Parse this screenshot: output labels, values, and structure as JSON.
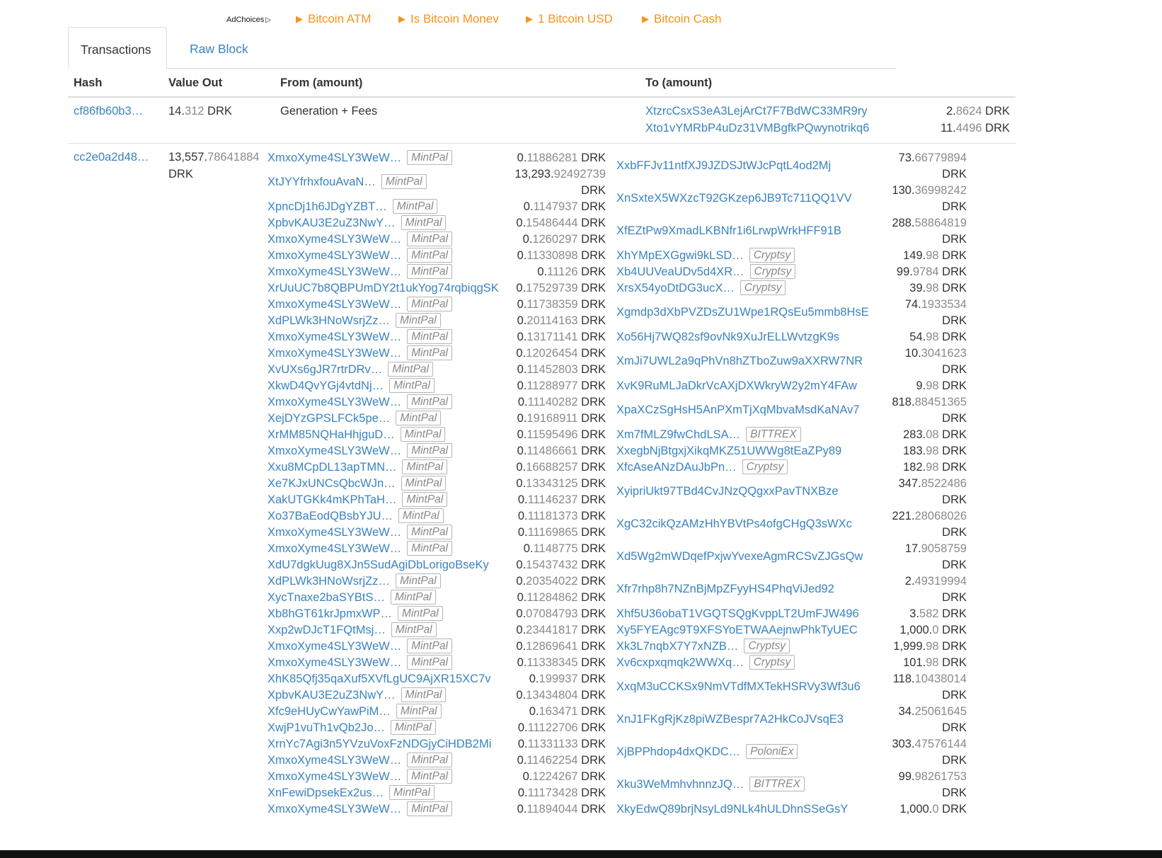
{
  "ads": {
    "adchoices": "AdChoices",
    "links": [
      "Bitcoin ATM",
      "Is Bitcoin Monev",
      "1 Bitcoin USD",
      "Bitcoin Cash"
    ]
  },
  "tabs": {
    "transactions": "Transactions",
    "raw_block": "Raw Block"
  },
  "headers": {
    "hash": "Hash",
    "value_out": "Value Out",
    "from": "From (amount)",
    "to": "To (amount)"
  },
  "coinbase_tx": {
    "hash": "cf86fb60b3…",
    "value_int": "14.",
    "value_dec": "312",
    "value_unit": " DRK",
    "from": "Generation + Fees",
    "to": [
      {
        "addr": "XtzrcCsxS3eA3LejArCt7F7BdWC33MR9ry",
        "int": "2.",
        "dec": "8624"
      },
      {
        "addr": "Xto1vYMRbP4uDz31VMBgfkPQwynotrikq6",
        "int": "11.",
        "dec": "4496"
      }
    ]
  },
  "big_tx": {
    "hash": "cc2e0a2d48…",
    "value_int": "13,557.",
    "value_dec": "78641884",
    "value_unit": "DRK",
    "inputs": [
      {
        "addr": "XmxoXyme4SLY3WeW…",
        "tag": "MintPal",
        "int": "0.",
        "dec": "11886281"
      },
      {
        "addr": "XtJYYfrhxfouAvaN…",
        "tag": "MintPal",
        "int": "13,293.",
        "dec": "92492739"
      },
      {
        "addr": "XpncDj1h6JDgYZBT…",
        "tag": "MintPal",
        "int": "0.",
        "dec": "1147937"
      },
      {
        "addr": "XpbvKAU3E2uZ3NwY…",
        "tag": "MintPal",
        "int": "0.",
        "dec": "15486444"
      },
      {
        "addr": "XmxoXyme4SLY3WeW…",
        "tag": "MintPal",
        "int": "0.",
        "dec": "1260297"
      },
      {
        "addr": "XmxoXyme4SLY3WeW…",
        "tag": "MintPal",
        "int": "0.",
        "dec": "11330898"
      },
      {
        "addr": "XmxoXyme4SLY3WeW…",
        "tag": "MintPal",
        "int": "0.",
        "dec": "11126"
      },
      {
        "addr": "XrUuUC7b8QBPUmDY2t1ukYog74rqbiqgSK",
        "tag": "",
        "int": "0.",
        "dec": "17529739"
      },
      {
        "addr": "XmxoXyme4SLY3WeW…",
        "tag": "MintPal",
        "int": "0.",
        "dec": "11738359"
      },
      {
        "addr": "XdPLWk3HNoWsrjZz…",
        "tag": "MintPal",
        "int": "0.",
        "dec": "20114163"
      },
      {
        "addr": "XmxoXyme4SLY3WeW…",
        "tag": "MintPal",
        "int": "0.",
        "dec": "13171141"
      },
      {
        "addr": "XmxoXyme4SLY3WeW…",
        "tag": "MintPal",
        "int": "0.",
        "dec": "12026454"
      },
      {
        "addr": "XvUXs6gJR7rtrDRv…",
        "tag": "MintPal",
        "int": "0.",
        "dec": "11452803"
      },
      {
        "addr": "XkwD4QvYGj4vtdNj…",
        "tag": "MintPal",
        "int": "0.",
        "dec": "11288977"
      },
      {
        "addr": "XmxoXyme4SLY3WeW…",
        "tag": "MintPal",
        "int": "0.",
        "dec": "11140282"
      },
      {
        "addr": "XejDYzGPSLFCk5pe…",
        "tag": "MintPal",
        "int": "0.",
        "dec": "19168911"
      },
      {
        "addr": "XrMM85NQHaHhjguD…",
        "tag": "MintPal",
        "int": "0.",
        "dec": "11595496"
      },
      {
        "addr": "XmxoXyme4SLY3WeW…",
        "tag": "MintPal",
        "int": "0.",
        "dec": "11486661"
      },
      {
        "addr": "Xxu8MCpDL13apTMN…",
        "tag": "MintPal",
        "int": "0.",
        "dec": "16688257"
      },
      {
        "addr": "Xe7KJxUNCsQbcWJn…",
        "tag": "MintPal",
        "int": "0.",
        "dec": "13343125"
      },
      {
        "addr": "XakUTGKk4mKPhTaH…",
        "tag": "MintPal",
        "int": "0.",
        "dec": "11146237"
      },
      {
        "addr": "Xo37BaEodQBsbYJU…",
        "tag": "MintPal",
        "int": "0.",
        "dec": "11181373"
      },
      {
        "addr": "XmxoXyme4SLY3WeW…",
        "tag": "MintPal",
        "int": "0.",
        "dec": "11169865"
      },
      {
        "addr": "XmxoXyme4SLY3WeW…",
        "tag": "MintPal",
        "int": "0.",
        "dec": "1148775"
      },
      {
        "addr": "XdU7dgkUug8XJn5SudAgiDbLorigoBseKy",
        "tag": "",
        "int": "0.",
        "dec": "15437432"
      },
      {
        "addr": "XdPLWk3HNoWsrjZz…",
        "tag": "MintPal",
        "int": "0.",
        "dec": "20354022"
      },
      {
        "addr": "XycTnaxe2baSYBtS…",
        "tag": "MintPal",
        "int": "0.",
        "dec": "11284862"
      },
      {
        "addr": "Xb8hGT61krJpmxWP…",
        "tag": "MintPal",
        "int": "0.",
        "dec": "07084793"
      },
      {
        "addr": "Xxp2wDJcT1FQtMsj…",
        "tag": "MintPal",
        "int": "0.",
        "dec": "23441817"
      },
      {
        "addr": "XmxoXyme4SLY3WeW…",
        "tag": "MintPal",
        "int": "0.",
        "dec": "12869641"
      },
      {
        "addr": "XmxoXyme4SLY3WeW…",
        "tag": "MintPal",
        "int": "0.",
        "dec": "11338345"
      },
      {
        "addr": "XhK85Qfj35qaXuf5XVfLgUC9AjXR15XC7v",
        "tag": "",
        "int": "0.",
        "dec": "199937"
      },
      {
        "addr": "XpbvKAU3E2uZ3NwY…",
        "tag": "MintPal",
        "int": "0.",
        "dec": "13434804"
      },
      {
        "addr": "Xfc9eHUyCwYawPiM…",
        "tag": "MintPal",
        "int": "0.",
        "dec": "163471"
      },
      {
        "addr": "XwjP1vuTh1vQb2Jo…",
        "tag": "MintPal",
        "int": "0.",
        "dec": "11122706"
      },
      {
        "addr": "XrnYc7Agi3n5YVzuVoxFzNDGjyCiHDB2Mi",
        "tag": "",
        "int": "0.",
        "dec": "11331133"
      },
      {
        "addr": "XmxoXyme4SLY3WeW…",
        "tag": "MintPal",
        "int": "0.",
        "dec": "11462254"
      },
      {
        "addr": "XmxoXyme4SLY3WeW…",
        "tag": "MintPal",
        "int": "0.",
        "dec": "1224267"
      },
      {
        "addr": "XnFewiDpsekEx2us…",
        "tag": "MintPal",
        "int": "0.",
        "dec": "11173428"
      },
      {
        "addr": "XmxoXyme4SLY3WeW…",
        "tag": "MintPal",
        "int": "0.",
        "dec": "11894044"
      }
    ],
    "outputs": [
      {
        "addr": "XxbFFJv11ntfXJ9JZDSJtWJcPqtL4od2Mj",
        "tag": "",
        "int": "73.",
        "dec": "66779894",
        "wrap": true
      },
      {
        "addr": "XnSxteX5WXzcT92GKzep6JB9Tc711QQ1VV",
        "tag": "",
        "int": "130.",
        "dec": "36998242",
        "wrap": true
      },
      {
        "addr": "XfEZtPw9XmadLKBNfr1i6LrwpWrkHFF91B",
        "tag": "",
        "int": "288.",
        "dec": "58864819",
        "wrap": true
      },
      {
        "addr": "XhYMpEXGgwi9kLSD…",
        "tag": "Cryptsy",
        "int": "149.",
        "dec": "98",
        "wrap": false
      },
      {
        "addr": "Xb4UUVeaUDv5d4XR…",
        "tag": "Cryptsy",
        "int": "99.",
        "dec": "9784",
        "wrap": false
      },
      {
        "addr": "XrsX54yoDtDG3ucX…",
        "tag": "Cryptsy",
        "int": "39.",
        "dec": "98",
        "wrap": false
      },
      {
        "addr": "Xgmdp3dXbPVZDsZU1Wpe1RQsEu5mmb8HsE",
        "tag": "",
        "int": "74.",
        "dec": "1933534",
        "wrap": true
      },
      {
        "addr": "Xo56Hj7WQ82sf9ovNk9XuJrELLWvtzgK9s",
        "tag": "",
        "int": "54.",
        "dec": "98",
        "wrap": false
      },
      {
        "addr": "XmJi7UWL2a9qPhVn8hZTboZuw9aXXRW7NR",
        "tag": "",
        "int": "10.",
        "dec": "3041623",
        "wrap": true
      },
      {
        "addr": "XvK9RuMLJaDkrVcAXjDXWkryW2y2mY4FAw",
        "tag": "",
        "int": "9.",
        "dec": "98",
        "wrap": false
      },
      {
        "addr": "XpaXCzSgHsH5AnPXmTjXqMbvaMsdKaNAv7",
        "tag": "",
        "int": "818.",
        "dec": "88451365",
        "wrap": true
      },
      {
        "addr": "Xm7fMLZ9fwChdLSA…",
        "tag": "BITTREX",
        "int": "283.",
        "dec": "08",
        "wrap": false
      },
      {
        "addr": "XxegbNjBtgxjXikqMKZ51UWWg8tEaZPy89",
        "tag": "",
        "int": "183.",
        "dec": "98",
        "wrap": false
      },
      {
        "addr": "XfcAseANzDAuJbPn…",
        "tag": "Cryptsy",
        "int": "182.",
        "dec": "98",
        "wrap": false
      },
      {
        "addr": "XyipriUkt97TBd4CvJNzQQgxxPavTNXBze",
        "tag": "",
        "int": "347.",
        "dec": "8522486",
        "wrap": true
      },
      {
        "addr": "XgC32cikQzAMzHhYBVtPs4ofgCHgQ3sWXc",
        "tag": "",
        "int": "221.",
        "dec": "28068026",
        "wrap": true
      },
      {
        "addr": "Xd5Wg2mWDqefPxjwYvexeAgmRCSvZJGsQw",
        "tag": "",
        "int": "17.",
        "dec": "9058759",
        "wrap": true
      },
      {
        "addr": "Xfr7rhp8h7NZnBjMpZFyyHS4PhqViJed92",
        "tag": "",
        "int": "2.",
        "dec": "49319994",
        "wrap": true
      },
      {
        "addr": "Xhf5U36obaT1VGQTSQgKvppLT2UmFJW496",
        "tag": "",
        "int": "3.",
        "dec": "582",
        "wrap": false
      },
      {
        "addr": "Xy5FYEAgc9T9XFSYoETWAAejnwPhkTyUEC",
        "tag": "",
        "int": "1,000.",
        "dec": "0",
        "wrap": false
      },
      {
        "addr": "Xk3L7nqbX7Y7xNZB…",
        "tag": "Cryptsy",
        "int": "1,999.",
        "dec": "98",
        "wrap": false
      },
      {
        "addr": "Xv6cxpxqmqk2WWXq…",
        "tag": "Cryptsy",
        "int": "101.",
        "dec": "98",
        "wrap": false
      },
      {
        "addr": "XxqM3uCCKSx9NmVTdfMXTekHSRVy3Wf3u6",
        "tag": "",
        "int": "118.",
        "dec": "10438014",
        "wrap": true
      },
      {
        "addr": "XnJ1FKgRjKz8piWZBespr7A2HkCoJVsqE3",
        "tag": "",
        "int": "34.",
        "dec": "25061645",
        "wrap": true
      },
      {
        "addr": "XjBPPhdop4dxQKDC…",
        "tag": "PoloniEx",
        "int": "303.",
        "dec": "47576144",
        "wrap": true
      },
      {
        "addr": "Xku3WeMmhvhnnzJQ…",
        "tag": "BITTREX",
        "int": "99.",
        "dec": "98261753",
        "wrap": true
      },
      {
        "addr": "XkyEdwQ89brjNsyLd9NLk4hULDhnSSeGsY",
        "tag": "",
        "int": "1,000.",
        "dec": "0",
        "wrap": false
      }
    ]
  },
  "unit": "DRK",
  "colors": {
    "link": "#3b83c0",
    "ad": "#f7931a",
    "tag_border": "#b5b5b5",
    "muted": "#8a8a8a"
  }
}
